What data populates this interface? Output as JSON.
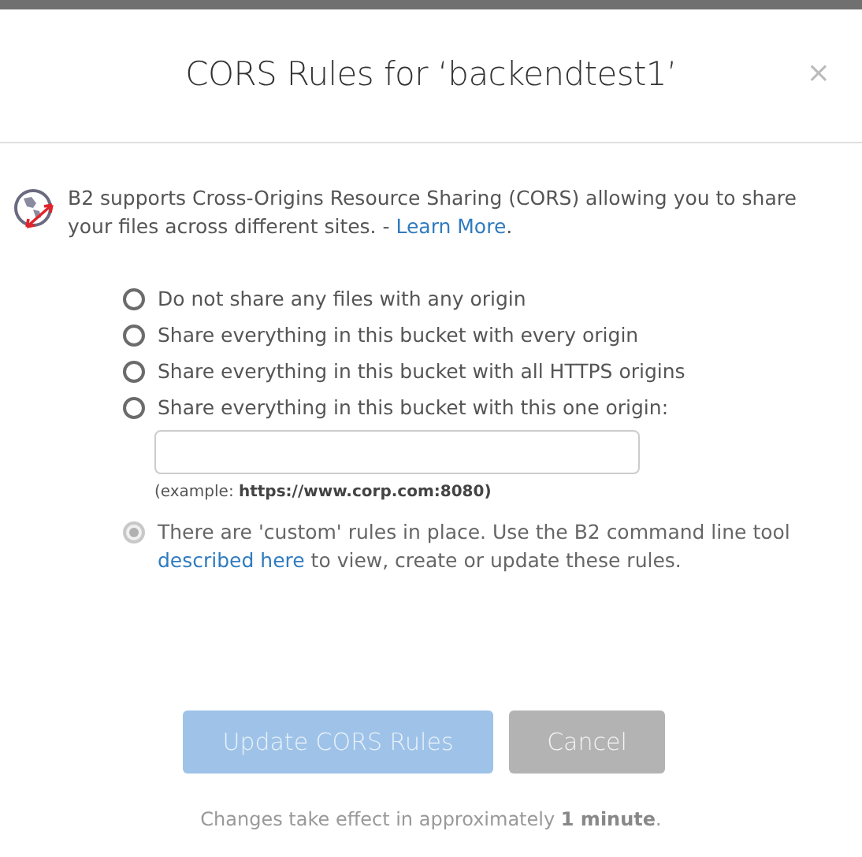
{
  "dialog": {
    "title": "CORS Rules for ‘backendtest1’",
    "close": "×"
  },
  "intro": {
    "text": "B2 supports Cross-Origins Resource Sharing (CORS) allowing you to share your files across different sites. - ",
    "link": "Learn More",
    "after": "."
  },
  "options": [
    {
      "kind": "plain",
      "label": "Do not share any files with any origin",
      "selected": false,
      "disabled": false
    },
    {
      "kind": "plain",
      "label": "Share everything in this bucket with every origin",
      "selected": false,
      "disabled": false
    },
    {
      "kind": "plain",
      "label": "Share everything in this bucket with all HTTPS origins",
      "selected": false,
      "disabled": false
    },
    {
      "kind": "origin",
      "label": "Share everything in this bucket with this one origin:",
      "selected": false,
      "disabled": false,
      "example_prefix": "(example: ",
      "example_value": "https://www.corp.com:8080)"
    },
    {
      "kind": "custom",
      "label": "There are 'custom' rules in place. Use the B2 command line tool ",
      "link": "described here",
      "after": " to view, create or update these rules.",
      "selected": true,
      "disabled": true
    }
  ],
  "buttons": [
    {
      "kind": "primary",
      "label": "Update CORS Rules",
      "disabled": true
    },
    {
      "kind": "secondary",
      "label": "Cancel",
      "disabled": false
    }
  ],
  "footer": {
    "text": "Changes take effect in approximately ",
    "bold": "1 minute",
    "after": "."
  }
}
